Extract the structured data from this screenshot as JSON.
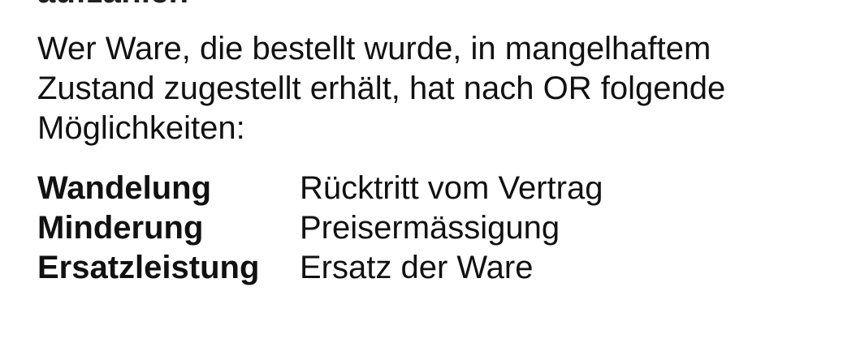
{
  "top_heading_partial": "aufzählen",
  "intro_text": "Wer Ware, die bestellt wurde, in mangelhaftem Zustand zugestellt erhält, hat nach OR folgende Möglichkeiten:",
  "terms": [
    {
      "term": "Wandelung",
      "meaning": "Rücktritt vom Vertrag"
    },
    {
      "term": "Minderung",
      "meaning": "Preisermässigung"
    },
    {
      "term": "Ersatzleistung",
      "meaning": "Ersatz der Ware"
    }
  ],
  "colors": {
    "background": "#ffffff",
    "text": "#111111"
  }
}
